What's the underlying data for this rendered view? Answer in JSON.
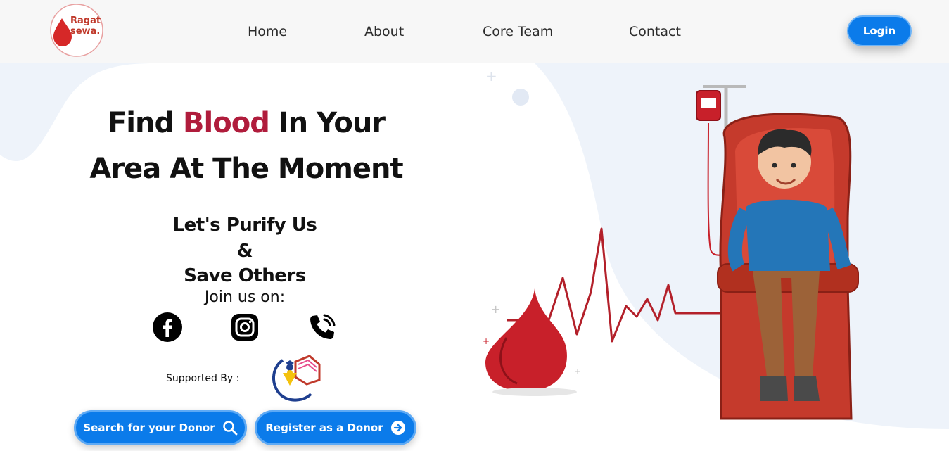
{
  "brand": {
    "line1": "Ragat",
    "line2": "sewa."
  },
  "nav": {
    "links": [
      {
        "label": "Home"
      },
      {
        "label": "About"
      },
      {
        "label": "Core Team"
      },
      {
        "label": "Contact"
      }
    ],
    "login_label": "Login"
  },
  "hero": {
    "title_part1": "Find ",
    "title_accent": "Blood",
    "title_part2": " In Your",
    "title_line2": "Area At The Moment",
    "tagline_line1": "Let's Purify Us",
    "tagline_line2": "&",
    "tagline_line3": "Save Others",
    "join_label": "Join us on:"
  },
  "social": {
    "icons": [
      "facebook-icon",
      "instagram-icon",
      "phone-call-icon"
    ]
  },
  "support": {
    "label": "Supported By :"
  },
  "actions": {
    "search_label": "Search for your Donor",
    "register_label": "Register as a Donor"
  },
  "colors": {
    "primary": "#0b7bea",
    "accent": "#b01c3c",
    "navbar_bg": "#f7f7f7",
    "blob": "#eef3fa"
  }
}
